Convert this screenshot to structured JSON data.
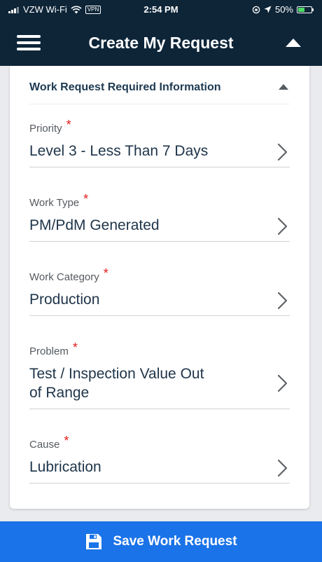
{
  "status_bar": {
    "carrier": "VZW Wi-Fi",
    "vpn": "VPN",
    "time": "2:54 PM",
    "battery": "50%",
    "battery_level": 0.5
  },
  "header": {
    "title": "Create My Request"
  },
  "section": {
    "title": "Work Request Required Information"
  },
  "fields": {
    "priority": {
      "label": "Priority",
      "required": "*",
      "value": "Level 3 - Less Than 7 Days"
    },
    "work_type": {
      "label": "Work Type",
      "required": "*",
      "value": "PM/PdM Generated"
    },
    "work_category": {
      "label": "Work Category",
      "required": "*",
      "value": "Production"
    },
    "problem": {
      "label": "Problem",
      "required": "*",
      "value_line1": "Test / Inspection Value Out",
      "value_line2": "of Range"
    },
    "cause": {
      "label": "Cause",
      "required": "*",
      "value": "Lubrication"
    }
  },
  "save_button": {
    "label": "Save Work Request"
  },
  "colors": {
    "header_bg": "#0e2538",
    "accent": "#1a73e8",
    "required": "#e21b1b",
    "battery": "#4cd964"
  },
  "icons": {
    "menu": "hamburger-menu-icon",
    "collapse": "triangle-up-icon",
    "chevron": "chevron-right-icon",
    "save": "floppy-disk-icon"
  }
}
